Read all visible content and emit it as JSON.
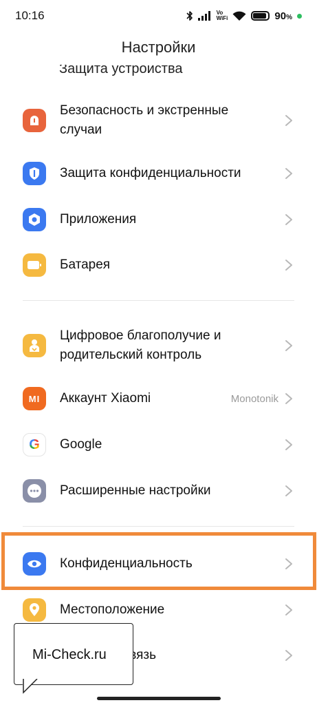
{
  "status_bar": {
    "time": "10:16",
    "vo_label": "Vo",
    "wifi_label": "WiFi",
    "battery_percent": "90",
    "battery_suffix": "%",
    "battery_level": 0.9,
    "indicator_color": "#2dbe60"
  },
  "header": {
    "title": "Настройки"
  },
  "clipped_item": {
    "label": "Защита устройства"
  },
  "items": [
    {
      "label": "Безопасность и экстренные случаи",
      "icon": "sos-icon",
      "color": "#e8643c"
    },
    {
      "label": "Защита конфиденциальности",
      "icon": "privacy-shield-icon",
      "color": "#3b79f0"
    },
    {
      "label": "Приложения",
      "icon": "apps-hexagon-icon",
      "color": "#3b79f0"
    },
    {
      "label": "Батарея",
      "icon": "battery-icon",
      "color": "#f5b940"
    },
    {
      "label": "Цифровое благополучие и родительский контроль",
      "icon": "wellbeing-person-icon",
      "color": "#f5b940"
    },
    {
      "label": "Аккаунт Xiaomi",
      "value": "Monotonik",
      "icon": "mi-logo-icon",
      "color": "#f06a20"
    },
    {
      "label": "Google",
      "icon": "google-icon",
      "color": "#ffffff"
    },
    {
      "label": "Расширенные настройки",
      "icon": "more-dots-icon",
      "color": "#8a8fa8"
    },
    {
      "label": "Конфиденциальность",
      "icon": "eye-icon",
      "color": "#3b79f0"
    },
    {
      "label": "Местоположение",
      "icon": "location-pin-icon",
      "color": "#f5b940"
    },
    {
      "label": "Обратная связь",
      "icon": "feedback-icon",
      "color": "#3b79f0"
    }
  ],
  "mi_logo_text": "MI",
  "google_letter": "G",
  "highlight_color": "#f08a3a",
  "watermark": {
    "text": "Mi-Check.ru"
  }
}
